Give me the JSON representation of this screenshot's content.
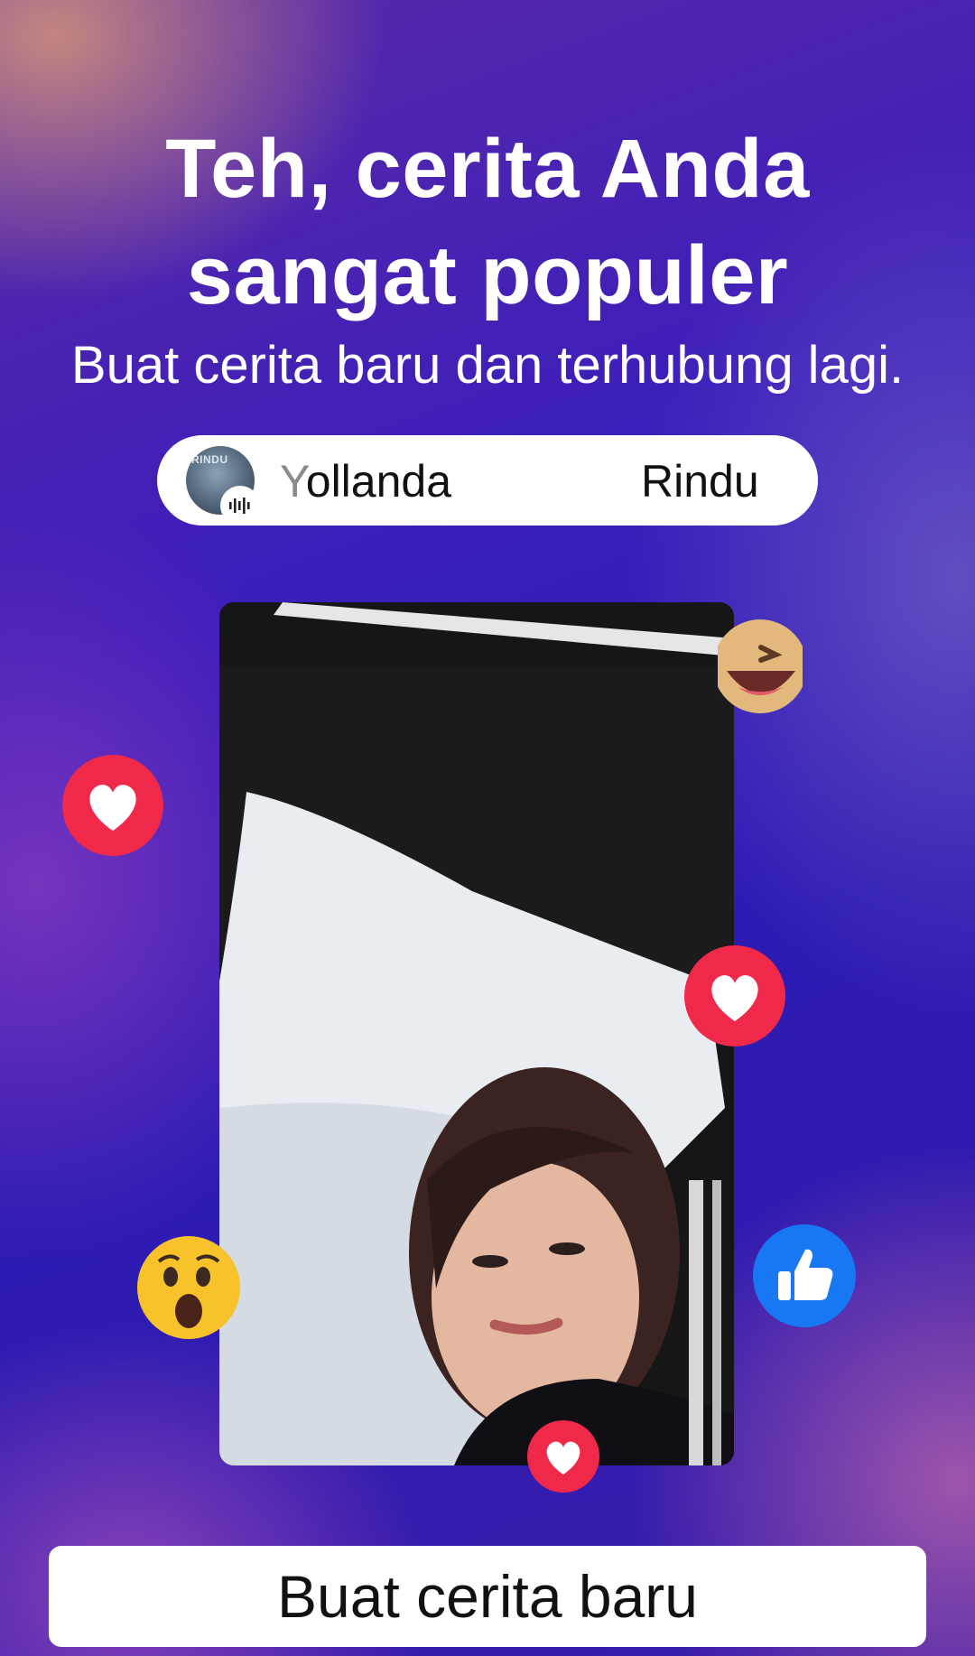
{
  "headline": {
    "line1": "Teh, cerita Anda",
    "line2": "sangat populer"
  },
  "subheadline": "Buat cerita baru dan terhubung lagi.",
  "music": {
    "cover_text": "RINDU",
    "artist_first": "Y",
    "artist_rest": "ollanda",
    "song": "Rindu"
  },
  "reactions": [
    "heart-icon",
    "haha-icon",
    "wow-icon",
    "like-icon"
  ],
  "colors": {
    "heart": "#f0284a",
    "like": "#1877f2",
    "button_bg": "#ffffff"
  },
  "cta_button": {
    "label": "Buat cerita baru"
  }
}
